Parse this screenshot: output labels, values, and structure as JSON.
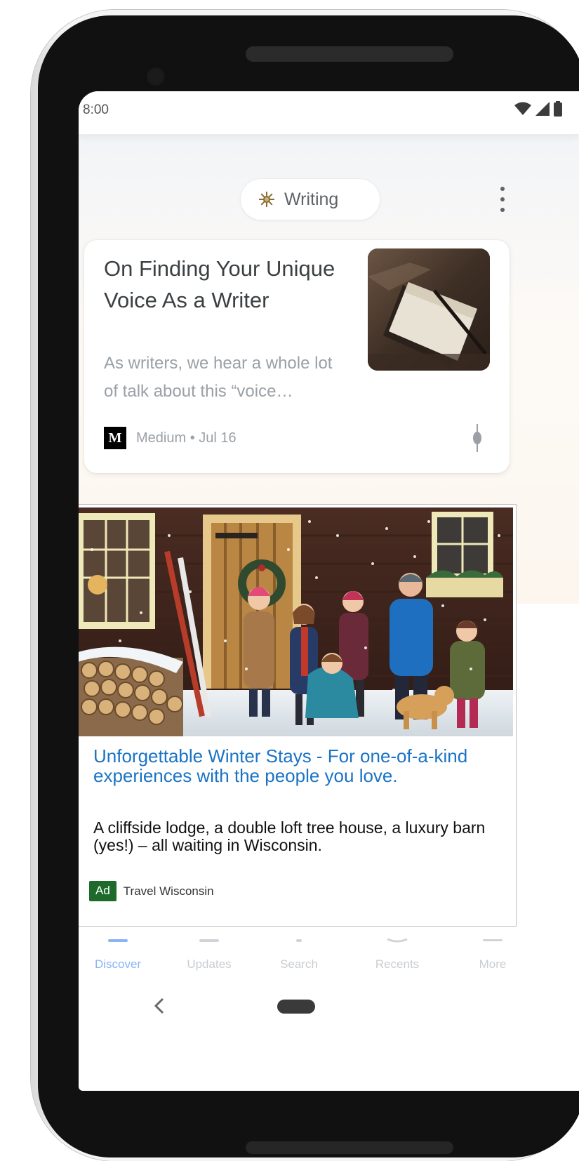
{
  "status_bar": {
    "time": "8:00"
  },
  "topic": {
    "label": "Writing"
  },
  "article": {
    "title": "On Finding Your Unique Voice As a Writer",
    "snippet": "As writers, we hear a whole lot of talk about this “voice…",
    "source_logo": "M",
    "source_meta": "Medium • Jul 16"
  },
  "ad": {
    "headline": "Unforgettable Winter Stays - For one-of-a-kind experiences with the people you love.",
    "description": "A cliffside lodge, a double loft tree house, a luxury barn (yes!) – all waiting in Wisconsin.",
    "badge": "Ad",
    "advertiser": "Travel Wisconsin"
  },
  "bottom_nav": {
    "items": [
      {
        "label": "Discover",
        "icon": "discover-icon",
        "active": true
      },
      {
        "label": "Updates",
        "icon": "updates-icon",
        "active": false
      },
      {
        "label": "Search",
        "icon": "search-icon",
        "active": false
      },
      {
        "label": "Recents",
        "icon": "recents-icon",
        "active": false
      },
      {
        "label": "More",
        "icon": "more-icon",
        "active": false
      }
    ]
  },
  "colors": {
    "ad_headline": "#1a73c4",
    "ad_badge": "#1e6a2a",
    "nav_active": "#8ab4f8"
  }
}
